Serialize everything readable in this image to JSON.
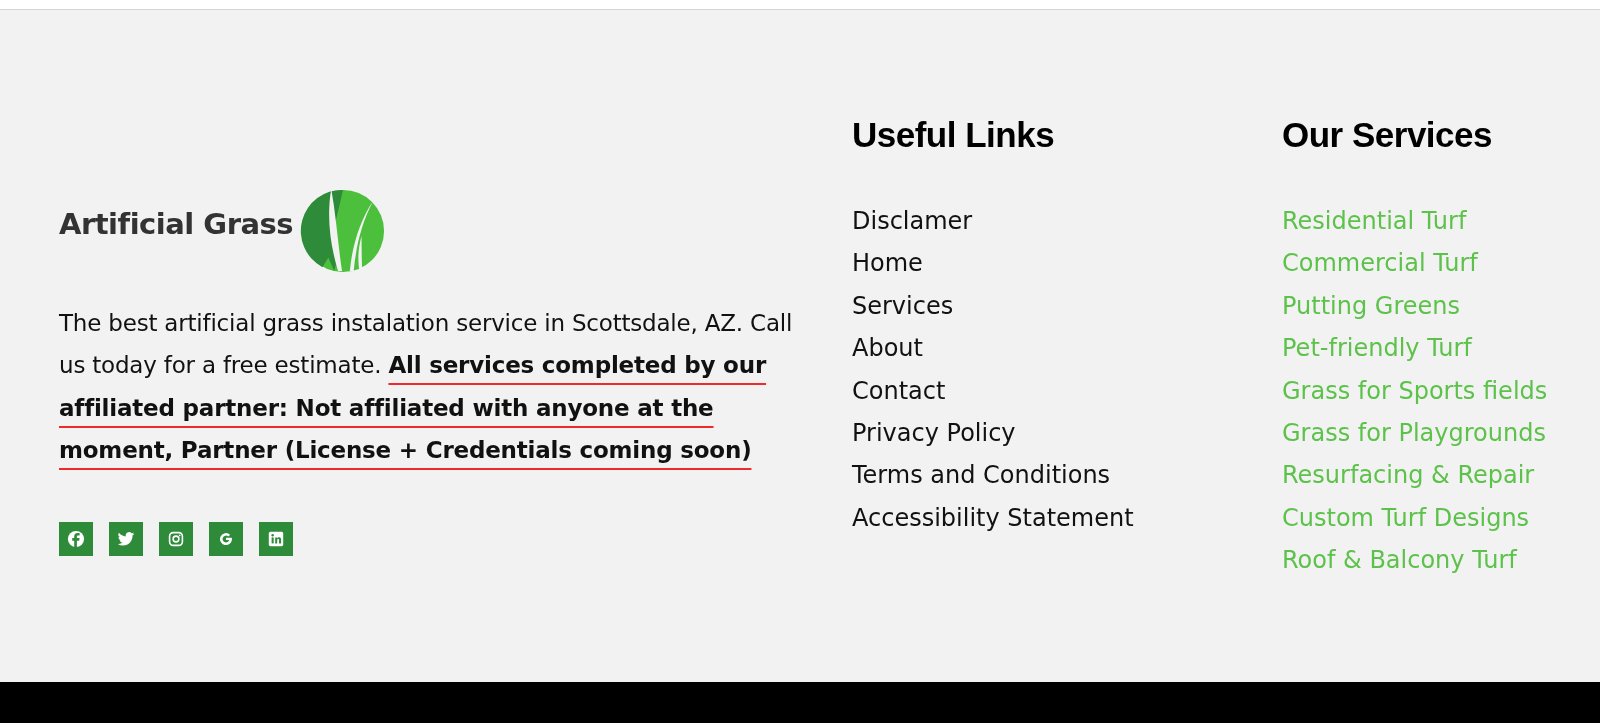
{
  "logo": {
    "text": "Artificial Grass"
  },
  "description": "The best artificial grass instalation service in Scottsdale, AZ. Call us today for a free estimate. **All services completed by our affiliated partner: Not affiliated with anyone at the moment, Partner (License + Credentials coming soon)**",
  "social_links": [
    {
      "kind": "facebook"
    },
    {
      "kind": "twitter"
    },
    {
      "kind": "instagram"
    },
    {
      "kind": "google"
    },
    {
      "kind": "linkedin"
    }
  ],
  "useful_links": {
    "title": "Useful Links",
    "items": [
      "Disclamer",
      "Home",
      "Services",
      "About",
      "Contact",
      "Privacy Policy",
      "Terms and Conditions",
      "Accessibility Statement"
    ]
  },
  "services": {
    "title": "Our Services",
    "items": [
      "Residential Turf",
      "Commercial Turf",
      "Putting Greens",
      "Pet-friendly Turf",
      "Grass for Sports fields",
      "Grass for Playgrounds",
      "Resurfacing & Repair",
      "Custom Turf Designs",
      "Roof & Balcony Turf"
    ]
  }
}
